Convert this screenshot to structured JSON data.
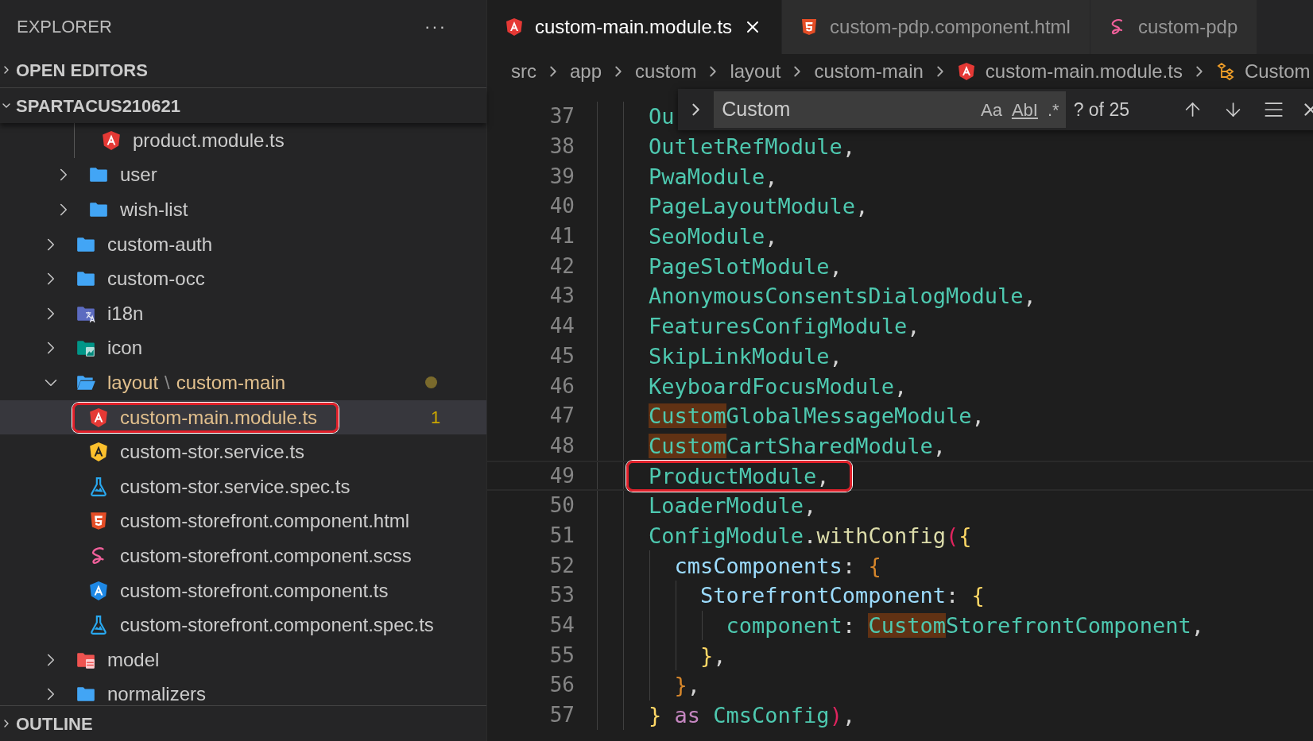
{
  "sidebar": {
    "title": "EXPLORER",
    "more": "···",
    "sections_top": [
      {
        "label": "OPEN EDITORS",
        "expanded": false
      },
      {
        "label": "SPARTACUS210621",
        "expanded": true
      }
    ],
    "path_separator": "\\",
    "tree": [
      {
        "kind": "group",
        "children": [
          {
            "kind": "group",
            "children": [
              {
                "kind": "angular-module",
                "label": "product.module.ts",
                "selected": false
              }
            ]
          },
          {
            "kind": "folder",
            "label": "user",
            "expanded": false,
            "selected": false
          },
          {
            "kind": "folder",
            "label": "wish-list",
            "expanded": false,
            "selected": false
          }
        ]
      },
      {
        "kind": "folder",
        "label": "custom-auth",
        "expanded": false,
        "selected": false
      },
      {
        "kind": "folder",
        "label": "custom-occ",
        "expanded": false,
        "selected": false
      },
      {
        "kind": "i18n-folder",
        "label": "i18n",
        "expanded": false,
        "selected": false
      },
      {
        "kind": "image-folder",
        "label": "icon",
        "expanded": false,
        "selected": false
      },
      {
        "kind": "folder",
        "path": [
          "layout",
          "custom-main"
        ],
        "expanded": true,
        "modified": true,
        "selected": false,
        "children": [
          {
            "kind": "angular-module",
            "label": "custom-main.module.ts",
            "selected": true,
            "modified": true,
            "problems": "1",
            "annotated": true
          },
          {
            "kind": "angular-service",
            "label": "custom-stor.service.ts",
            "selected": false,
            "modified": false
          },
          {
            "kind": "test",
            "label": "custom-stor.service.spec.ts",
            "selected": false,
            "modified": false
          },
          {
            "kind": "html",
            "label": "custom-storefront.component.html",
            "selected": false,
            "modified": false
          },
          {
            "kind": "sass",
            "label": "custom-storefront.component.scss",
            "selected": false,
            "modified": false
          },
          {
            "kind": "angular-component",
            "label": "custom-storefront.component.ts",
            "selected": false,
            "modified": false
          },
          {
            "kind": "test",
            "label": "custom-storefront.component.spec.ts",
            "selected": false,
            "modified": false
          }
        ]
      },
      {
        "kind": "model-folder",
        "label": "model",
        "expanded": false,
        "selected": false
      },
      {
        "kind": "folder",
        "label": "normalizers",
        "expanded": false,
        "selected": false
      }
    ],
    "sections_bottom": [
      {
        "label": "OUTLINE",
        "expanded": false
      }
    ]
  },
  "tabs": [
    {
      "label": "custom-main.module.ts",
      "kind": "angular-module",
      "selected": true
    },
    {
      "label": "custom-pdp.component.html",
      "kind": "html",
      "selected": false
    },
    {
      "label": "custom-pdp",
      "kind": "sass",
      "selected": false
    }
  ],
  "breadcrumb": [
    {
      "label": "src",
      "kind": "folder"
    },
    {
      "label": "app",
      "kind": "folder"
    },
    {
      "label": "custom",
      "kind": "folder"
    },
    {
      "label": "layout",
      "kind": "folder"
    },
    {
      "label": "custom-main",
      "kind": "folder"
    },
    {
      "label": "custom-main.module.ts",
      "kind": "angular-module"
    },
    {
      "label": "Custom",
      "kind": "symbol"
    }
  ],
  "find": {
    "value": "Custom",
    "options": [
      "Aa",
      "AbI",
      ".*"
    ],
    "count": "? of 25"
  },
  "code": [
    {
      "number": "37",
      "segments": [
        {
          "text": "    Ou",
          "kind": "type"
        }
      ]
    },
    {
      "number": "38",
      "segments": [
        {
          "text": "    OutletRefModule",
          "kind": "type"
        },
        {
          "text": ",",
          "kind": "punct"
        }
      ]
    },
    {
      "number": "39",
      "segments": [
        {
          "text": "    PwaModule",
          "kind": "type"
        },
        {
          "text": ",",
          "kind": "punct"
        }
      ]
    },
    {
      "number": "40",
      "segments": [
        {
          "text": "    PageLayoutModule",
          "kind": "type"
        },
        {
          "text": ",",
          "kind": "punct"
        }
      ]
    },
    {
      "number": "41",
      "segments": [
        {
          "text": "    SeoModule",
          "kind": "type"
        },
        {
          "text": ",",
          "kind": "punct"
        }
      ]
    },
    {
      "number": "42",
      "segments": [
        {
          "text": "    PageSlotModule",
          "kind": "type"
        },
        {
          "text": ",",
          "kind": "punct"
        }
      ]
    },
    {
      "number": "43",
      "segments": [
        {
          "text": "    AnonymousConsentsDialogModule",
          "kind": "type"
        },
        {
          "text": ",",
          "kind": "punct"
        }
      ]
    },
    {
      "number": "44",
      "segments": [
        {
          "text": "    FeaturesConfigModule",
          "kind": "type"
        },
        {
          "text": ",",
          "kind": "punct"
        }
      ]
    },
    {
      "number": "45",
      "segments": [
        {
          "text": "    SkipLinkModule",
          "kind": "type"
        },
        {
          "text": ",",
          "kind": "punct"
        }
      ]
    },
    {
      "number": "46",
      "segments": [
        {
          "text": "    KeyboardFocusModule",
          "kind": "type"
        },
        {
          "text": ",",
          "kind": "punct"
        }
      ]
    },
    {
      "number": "47",
      "segments": [
        {
          "text": "    Custom",
          "kind": "type",
          "match": true
        },
        {
          "text": "GlobalMessageModule",
          "kind": "type"
        },
        {
          "text": ",",
          "kind": "punct"
        }
      ]
    },
    {
      "number": "48",
      "segments": [
        {
          "text": "    Custom",
          "kind": "type",
          "match": true
        },
        {
          "text": "CartSharedModule",
          "kind": "type"
        },
        {
          "text": ",",
          "kind": "punct"
        }
      ]
    },
    {
      "number": "49",
      "current": true,
      "annotated": true,
      "segments": [
        {
          "text": "    ProductModule",
          "kind": "type"
        },
        {
          "text": ",",
          "kind": "punct"
        }
      ]
    },
    {
      "number": "50",
      "segments": [
        {
          "text": "    LoaderModule",
          "kind": "type"
        },
        {
          "text": ",",
          "kind": "punct"
        }
      ]
    },
    {
      "number": "51",
      "segments": [
        {
          "text": "    ConfigModule",
          "kind": "type"
        },
        {
          "text": ".",
          "kind": "punct"
        },
        {
          "text": "withConfig",
          "kind": "function"
        },
        {
          "text": "(",
          "kind": "bracket-a"
        },
        {
          "text": "{",
          "kind": "bracket-b"
        }
      ]
    },
    {
      "number": "52",
      "segments": [
        {
          "text": "      cmsComponents",
          "kind": "property"
        },
        {
          "text": ": ",
          "kind": "punct"
        },
        {
          "text": "{",
          "kind": "bracket-c"
        }
      ]
    },
    {
      "number": "53",
      "segments": [
        {
          "text": "        StorefrontComponent",
          "kind": "property"
        },
        {
          "text": ": ",
          "kind": "punct"
        },
        {
          "text": "{",
          "kind": "bracket-b"
        }
      ]
    },
    {
      "number": "54",
      "segments": [
        {
          "text": "          component",
          "kind": "type"
        },
        {
          "text": ": ",
          "kind": "punct"
        },
        {
          "text": "Custom",
          "kind": "type",
          "match": true
        },
        {
          "text": "StorefrontComponent",
          "kind": "type"
        },
        {
          "text": ",",
          "kind": "punct"
        }
      ]
    },
    {
      "number": "55",
      "segments": [
        {
          "text": "        }",
          "kind": "bracket-b"
        },
        {
          "text": ",",
          "kind": "punct"
        }
      ]
    },
    {
      "number": "56",
      "segments": [
        {
          "text": "      }",
          "kind": "bracket-c"
        },
        {
          "text": ",",
          "kind": "punct"
        }
      ]
    },
    {
      "number": "57",
      "segments": [
        {
          "text": "    }",
          "kind": "bracket-b"
        },
        {
          "text": " as ",
          "kind": "keyword"
        },
        {
          "text": "CmsConfig",
          "kind": "type"
        },
        {
          "text": ")",
          "kind": "bracket-a"
        },
        {
          "text": ",",
          "kind": "punct"
        }
      ]
    }
  ]
}
